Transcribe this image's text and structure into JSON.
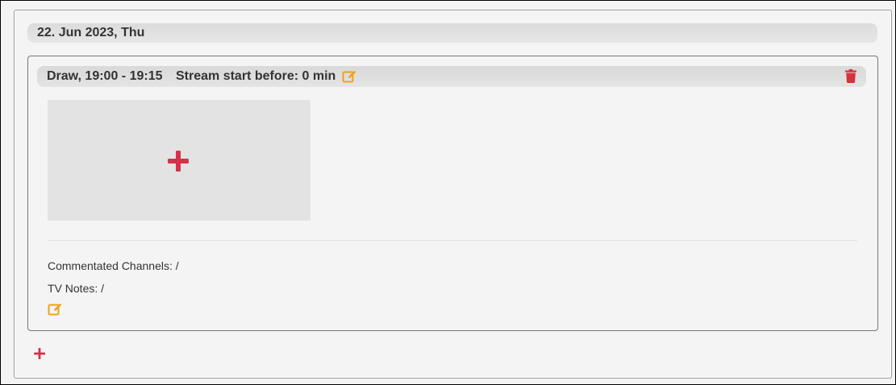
{
  "day": {
    "date_label": "22. Jun 2023, Thu"
  },
  "event": {
    "title": "Draw, 19:00 - 19:15",
    "stream_start": "Stream start before: 0 min",
    "commentated_channels_label": "Commentated Channels:",
    "commentated_channels_value": "/",
    "tv_notes_label": "TV Notes:",
    "tv_notes_value": "/"
  },
  "icons": {
    "edit": "edit-icon",
    "delete": "trash-icon",
    "add": "plus-icon"
  },
  "colors": {
    "edit_icon": "#f0a11a",
    "delete_icon": "#d7303f",
    "add_icon": "#d7304a"
  }
}
